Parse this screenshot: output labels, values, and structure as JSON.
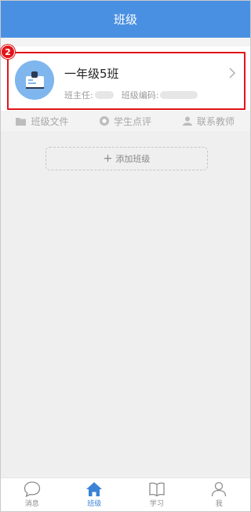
{
  "header": {
    "title": "班级"
  },
  "step_badge": "2",
  "class_card": {
    "name": "一年级5班",
    "teacher_label": "班主任:",
    "code_label": "班级编码:"
  },
  "actions": [
    {
      "label": "班级文件",
      "icon": "folder-icon"
    },
    {
      "label": "学生点评",
      "icon": "comment-icon"
    },
    {
      "label": "联系教师",
      "icon": "user-icon"
    }
  ],
  "add_class": {
    "plus": "+",
    "label": "添加班级"
  },
  "tabbar": [
    {
      "label": "消息",
      "icon": "message-icon",
      "active": false
    },
    {
      "label": "班级",
      "icon": "home-icon",
      "active": true
    },
    {
      "label": "学习",
      "icon": "book-icon",
      "active": false
    },
    {
      "label": "我",
      "icon": "profile-icon",
      "active": false
    }
  ],
  "colors": {
    "accent": "#4a90e2",
    "highlight": "#e0151a",
    "active_tab": "#3b82d6"
  }
}
